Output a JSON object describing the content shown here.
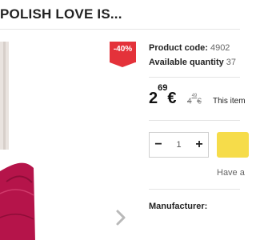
{
  "product": {
    "title": "POLISH LOVE IS...",
    "discount_badge": "-40%",
    "code_label": "Product code:",
    "code_value": "4902",
    "quantity_label": "Available quantity",
    "quantity_value": "37",
    "price_main": "2",
    "price_cents": "69",
    "price_currency": "€",
    "old_price_main": "4",
    "old_price_cents": "49",
    "old_price_currency": "€",
    "price_note": "This item",
    "manufacturer_label": "Manufacturer:"
  },
  "cart": {
    "minus_label": "−",
    "plus_label": "+",
    "quantity": "1",
    "have_a_text": "Have a"
  },
  "icons": {
    "next": "chevron-right-icon"
  },
  "colors": {
    "badge": "#e4323a",
    "add_to_cart": "#f6dc4a",
    "product_fabric": "#b5144a"
  }
}
